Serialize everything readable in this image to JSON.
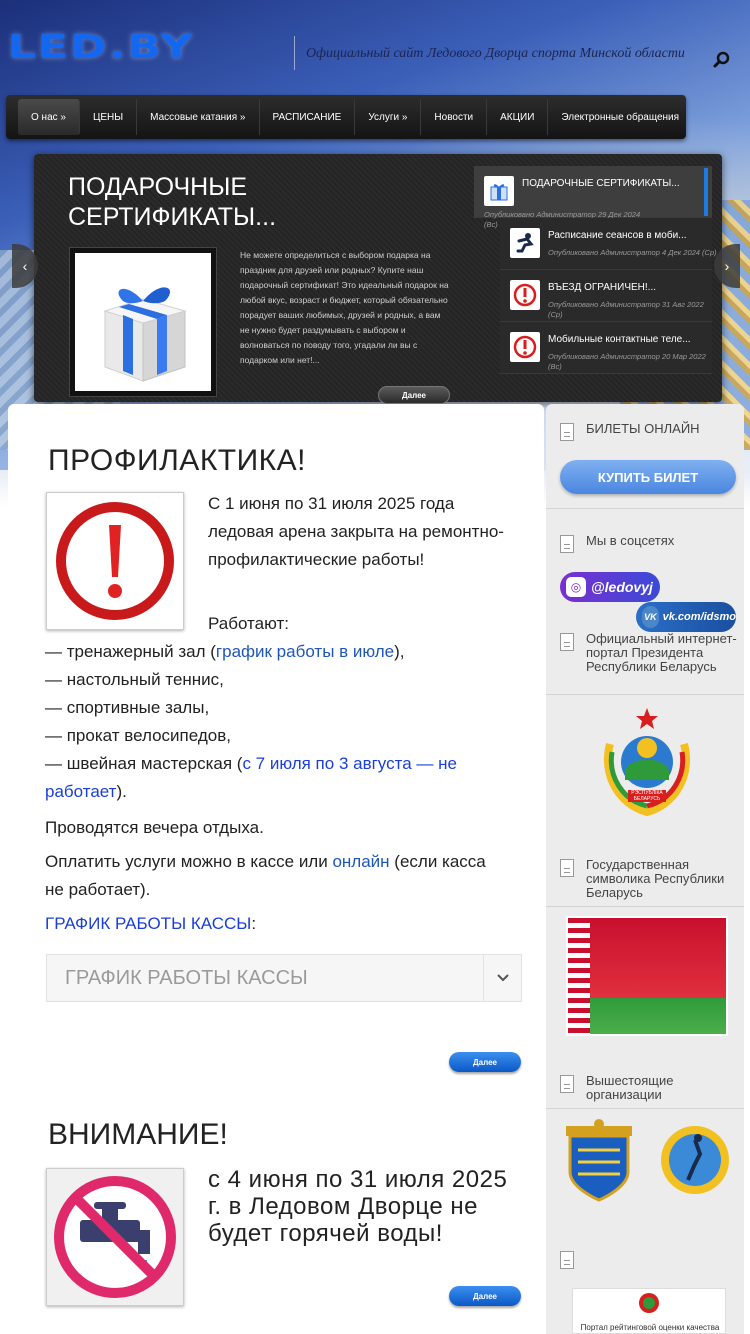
{
  "header": {
    "logo": "LED.BY",
    "tagline": "Официальный сайт Ледового Дворца спорта Минской области",
    "search_icon": "search-icon"
  },
  "nav": {
    "items": [
      {
        "label": "О нас »"
      },
      {
        "label": "ЦЕНЫ"
      },
      {
        "label": "Массовые катания »"
      },
      {
        "label": "РАСПИСАНИЕ"
      },
      {
        "label": "Услуги »"
      },
      {
        "label": "Новости"
      },
      {
        "label": "АКЦИИ"
      },
      {
        "label": "Электронные обращения"
      }
    ]
  },
  "slider": {
    "title": "ПОДАРОЧНЫЕ СЕРТИФИКАТЫ...",
    "text": "Не можете определиться с выбором подарка на праздник для друзей или родных? Купите наш подарочный сертификат! Это идеальный подарок на любой вкус, возраст и бюджет, который обязательно порадует ваших любимых, друзей и родных, а вам не нужно будет раздумывать с выбором и волноваться по поводу того, угадали ли вы с подарком или нет!...",
    "more_label": "Далее",
    "prev_icon": "chevron-left-icon",
    "next_icon": "chevron-right-icon",
    "items": [
      {
        "title": "ПОДАРОЧНЫЕ СЕРТИФИКАТЫ...",
        "meta": "Опубликовано Администратор 29 Дек 2024 (Вс)",
        "icon": "gift-icon"
      },
      {
        "title": "Расписание сеансов в моби...",
        "meta": "Опубликовано Администратор 4 Дек 2024 (Ср)",
        "icon": "skater-icon"
      },
      {
        "title": "ВЪЕЗД ОГРАНИЧЕН!...",
        "meta": "Опубликовано Администратор 31 Авг 2022 (Ср)",
        "icon": "exclamation-icon"
      },
      {
        "title": "Мобильные контактные теле...",
        "meta": "Опубликовано Администратор 20 Мар 2022 (Вс)",
        "icon": "exclamation-icon"
      }
    ]
  },
  "article1": {
    "title": "ПРОФИЛАКТИКА!",
    "intro": "С 1 июня по 31 июля 2025 года ледовая арена закрыта на ремонтно-профилактические работы!",
    "working_label": "Работают:",
    "line1_prefix": "— тренажерный зал (",
    "line1_link": "график работы в июле",
    "line1_suffix": "),",
    "line2": "— настольный теннис,",
    "line3": "— спортивные залы,",
    "line4": "— прокат велосипедов,",
    "line5_prefix": "— швейная мастерская (",
    "line5_link": "с 7 июля по 3 августа — не работает",
    "line5_suffix": ").",
    "evenings": "Проводятся вечера отдыха.",
    "pay_prefix": "Оплатить услуги можно в кассе или ",
    "pay_link": "онлайн",
    "pay_suffix": " (если касса не работает).",
    "schedule_link": "ГРАФИК РАБОТЫ КАССЫ",
    "schedule_colon": ":",
    "select_value": "ГРАФИК РАБОТЫ КАССЫ",
    "more_label": "Далее"
  },
  "article2": {
    "title": "ВНИМАНИЕ!",
    "text": "с 4 июня по 31 июля 2025 г. в Ледовом Дворце не будет горячей воды!",
    "more_label": "Далее"
  },
  "sidebar": {
    "tickets_heading": "БИЛЕТЫ ОНЛАЙН",
    "buy_label": "КУПИТЬ БИЛЕТ",
    "social_heading": "Мы в соцсетях",
    "instagram": "@ledovyj",
    "vk": "vk.com/idsmo",
    "portal_heading": "Официальный интернет-портал Президента Республики Беларусь",
    "symbols_heading": "Государственная символика Республики Беларусь",
    "orgs_heading": "Вышестоящие организации",
    "emblem_label": "РЭСПУБЛІКА БЕЛАРУСЬ",
    "portal_bottom": "Портал рейтинговой оценки качества"
  },
  "colors": {
    "accent": "#1468f0",
    "link": "#1f57b8",
    "nav_bg": "#1f1f1f",
    "button_blue": "#2a78e0"
  }
}
